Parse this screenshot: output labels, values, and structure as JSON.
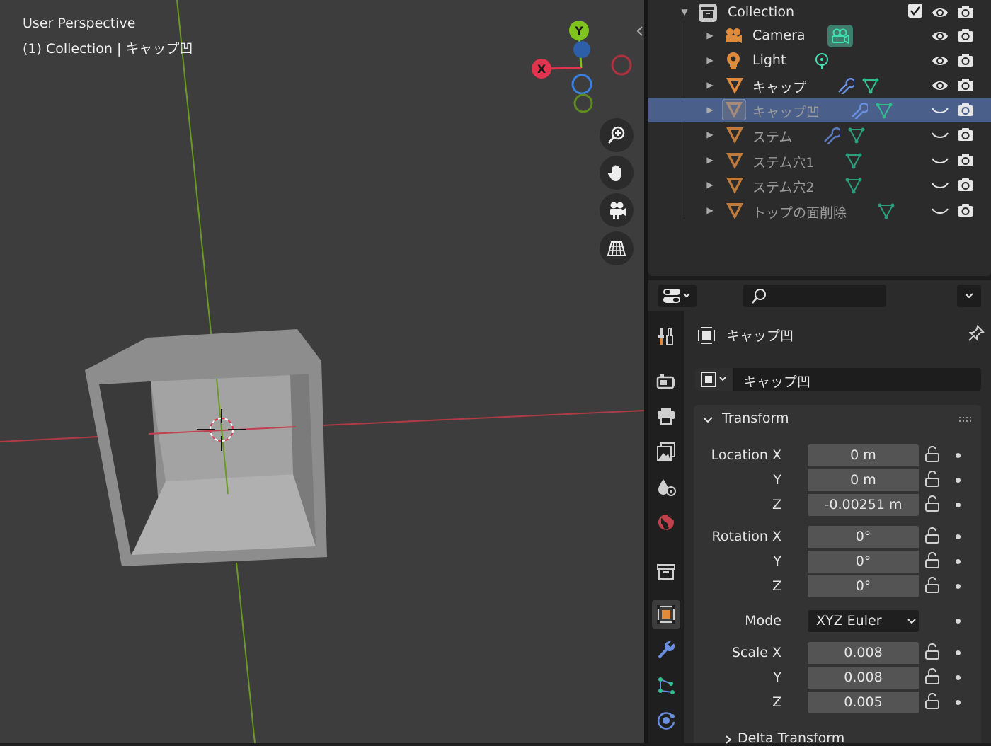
{
  "viewport": {
    "view_name": "User Perspective",
    "context_label": "(1) Collection | キャップ凹",
    "gizmo": {
      "x_label": "X",
      "y_label": "Y",
      "z_label": "Z"
    },
    "colors": {
      "x_axis": "#e0344f",
      "y_axis": "#7fc31d",
      "z_axis": "#3b7fe0",
      "background": "#3d3d3d"
    },
    "nav_buttons": [
      "zoom-icon",
      "pan-hand-icon",
      "camera-view-icon",
      "ortho-grid-icon"
    ]
  },
  "outliner": {
    "rows": [
      {
        "name": "Collection",
        "icon": "collection-icon",
        "expanded": true
      },
      {
        "name": "Camera",
        "icon": "camera-object-icon"
      },
      {
        "name": "Light",
        "icon": "light-object-icon"
      },
      {
        "name": "キャップ",
        "icon": "mesh-object-icon"
      },
      {
        "name": "キャップ凹",
        "icon": "mesh-object-icon",
        "selected": true
      },
      {
        "name": "ステム",
        "icon": "mesh-object-icon"
      },
      {
        "name": "ステム穴1",
        "icon": "mesh-object-icon"
      },
      {
        "name": "ステム穴2",
        "icon": "mesh-object-icon"
      },
      {
        "name": "トップの面削除",
        "icon": "mesh-object-icon"
      }
    ]
  },
  "properties": {
    "search_placeholder": "",
    "object_name": "キャップ凹",
    "datablock_name": "キャップ凹",
    "tabs": [
      "tool-icon",
      "render-icon",
      "output-icon",
      "view-layer-icon",
      "scene-icon",
      "world-icon",
      "collection-icon",
      "object-icon",
      "modifier-icon",
      "particles-icon",
      "physics-icon"
    ],
    "active_tab": "object-icon",
    "transform": {
      "title": "Transform",
      "location": {
        "label_x": "Location X",
        "label_y": "Y",
        "label_z": "Z",
        "x": "0 m",
        "y": "0 m",
        "z": "-0.00251 m"
      },
      "rotation": {
        "label_x": "Rotation X",
        "label_y": "Y",
        "label_z": "Z",
        "x": "0°",
        "y": "0°",
        "z": "0°"
      },
      "mode": {
        "label": "Mode",
        "value": "XYZ Euler"
      },
      "scale": {
        "label_x": "Scale X",
        "label_y": "Y",
        "label_z": "Z",
        "x": "0.008",
        "y": "0.008",
        "z": "0.005"
      }
    },
    "delta_transform_title": "Delta Transform"
  },
  "colors": {
    "selection": "#4a5f8a",
    "object_orange": "#e08a3c",
    "modifier_blue": "#6a8fe0",
    "mesh_green": "#2fbf8f"
  }
}
